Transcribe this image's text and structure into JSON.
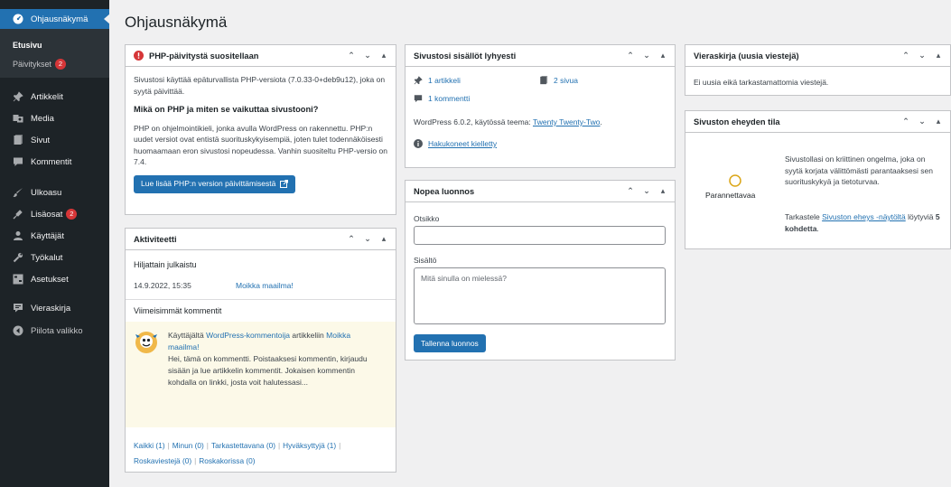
{
  "sidebar": {
    "active": {
      "label": "Ohjausnäkymä",
      "icon": "dashboard-icon"
    },
    "sub_home": "Etusivu",
    "sub_updates": "Päivitykset",
    "updates_count": "2",
    "items": [
      {
        "label": "Artikkelit",
        "icon": "pin-icon"
      },
      {
        "label": "Media",
        "icon": "media-icon"
      },
      {
        "label": "Sivut",
        "icon": "page-icon"
      },
      {
        "label": "Kommentit",
        "icon": "comment-icon"
      },
      {
        "label": "Ulkoasu",
        "icon": "brush-icon"
      },
      {
        "label": "Lisäosat",
        "icon": "plugin-icon",
        "badge": "2"
      },
      {
        "label": "Käyttäjät",
        "icon": "user-icon"
      },
      {
        "label": "Työkalut",
        "icon": "wrench-icon"
      },
      {
        "label": "Asetukset",
        "icon": "settings-icon"
      },
      {
        "label": "Vieraskirja",
        "icon": "guestbook-icon"
      },
      {
        "label": "Piilota valikko",
        "icon": "collapse-icon"
      }
    ]
  },
  "page_title": "Ohjausnäkymä",
  "php_card": {
    "title": "PHP-päivitystä suositellaan",
    "p1": "Sivustosi käyttää epäturvallista PHP-versiota (7.0.33-0+deb9u12), joka on syytä päivittää.",
    "heading": "Mikä on PHP ja miten se vaikuttaa sivustooni?",
    "p2": "PHP on ohjelmointikieli, jonka avulla WordPress on rakennettu. PHP:n uudet versiot ovat entistä suorituskykyisempiä, joten tulet todennäköisesti huomaamaan eron sivustosi nopeudessa. Vanhin suositeltu PHP-versio on 7.4.",
    "button": "Lue lisää PHP:n version päivittämisestä"
  },
  "activity": {
    "title": "Aktiviteetti",
    "recent_pub": "Hiljattain julkaistu",
    "post_date": "14.9.2022, 15:35",
    "post_title": "Moikka maailma!",
    "recent_comments": "Viimeisimmät kommentit",
    "comment_prefix": "Käyttäjältä",
    "comment_author": "WordPress-kommentoija",
    "comment_mid": "artikkeliin",
    "comment_post": "Moikka maailma!",
    "comment_text": "Hei, tämä on kommentti. Poistaaksesi kommentin, kirjaudu sisään ja lue artikkelin kommentit. Jokaisen kommentin kohdalla on linkki, josta voit halutessasi...",
    "filters": [
      "Kaikki (1)",
      "Minun (0)",
      "Tarkastettavana (0)",
      "Hyväksyttyjä (1)",
      "Roskaviestejä (0)",
      "Roskakorissa (0)"
    ]
  },
  "glance": {
    "title": "Sivustosi sisällöt lyhyesti",
    "posts": "1 artikkeli",
    "pages": "2 sivua",
    "comments": "1 kommentti",
    "wp_text": "WordPress 6.0.2, käytössä teema:",
    "theme": "Twenty Twenty-Two",
    "search_engines": "Hakukoneet kielletty"
  },
  "quick_draft": {
    "title": "Nopea luonnos",
    "title_label": "Otsikko",
    "content_label": "Sisältö",
    "content_placeholder": "Mitä sinulla on mielessä?",
    "button": "Tallenna luonnos"
  },
  "guestbook": {
    "title": "Vieraskirja (uusia viestejä)",
    "text": "Ei uusia eikä tarkastamattomia viestejä."
  },
  "health": {
    "title": "Sivuston eheyden tila",
    "status": "Parannettavaa",
    "text1": "Sivustollasi on kriittinen ongelma, joka on syytä korjata välittömästi parantaaksesi sen suorituskykyä ja tietoturvaa.",
    "text2_pre": "Tarkastele",
    "text2_link": "Sivuston eheys -näytöltä",
    "text2_mid": "löytyviä",
    "text2_bold": "5 kohdetta",
    "text2_end": "."
  },
  "colors": {
    "accent": "#2271b1",
    "sidebar": "#1d2327",
    "badge": "#d63638",
    "warning": "#dba617"
  }
}
